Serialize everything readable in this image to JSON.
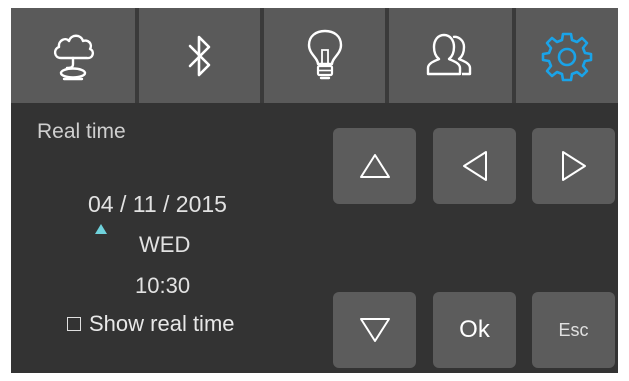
{
  "colors": {
    "panel_background": "#333333",
    "tab_background": "#5a5a5a",
    "button_background": "#5c5c5c",
    "active_accent": "#1aa3e8",
    "cursor_accent": "#6fd2dc"
  },
  "tabs": [
    {
      "icon": "weather-cloud-icon",
      "active": false
    },
    {
      "icon": "bluetooth-icon",
      "active": false
    },
    {
      "icon": "light-bulb-icon",
      "active": false
    },
    {
      "icon": "users-icon",
      "active": false
    },
    {
      "icon": "gear-icon",
      "active": true
    }
  ],
  "panel": {
    "title": "Real time",
    "date": "04 / 11 / 2015",
    "day": "WED",
    "time": "10:30",
    "cursor_field": "day"
  },
  "show_real_time": {
    "label": "Show real time",
    "checked": false
  },
  "buttons": {
    "up": {
      "icon": "triangle-up-icon"
    },
    "left": {
      "icon": "triangle-left-icon"
    },
    "right": {
      "icon": "triangle-right-icon"
    },
    "down": {
      "icon": "triangle-down-icon"
    },
    "ok": {
      "label": "Ok"
    },
    "esc": {
      "label": "Esc"
    }
  }
}
